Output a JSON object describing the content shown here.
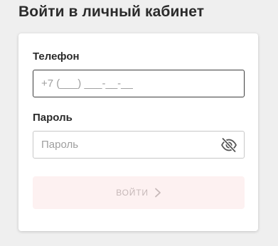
{
  "page": {
    "title": "Войти в личный кабинет"
  },
  "login_form": {
    "phone": {
      "label": "Телефон",
      "value": "",
      "placeholder": "+7 (___) ___-__-__"
    },
    "password": {
      "label": "Пароль",
      "value": "",
      "placeholder": "Пароль",
      "visibility_icon": "eye-off-icon"
    },
    "submit": {
      "label": "войти",
      "icon": "chevron-right-icon",
      "state": "disabled"
    }
  },
  "colors": {
    "background": "#efefef",
    "card": "#ffffff",
    "text": "#2b2b2b",
    "placeholder": "#9e9e9e",
    "active_border": "#3d3d3d",
    "inactive_border": "#c8c8c8",
    "disabled_button_bg": "#fdf1f1",
    "disabled_button_text": "#c6b8b8"
  }
}
